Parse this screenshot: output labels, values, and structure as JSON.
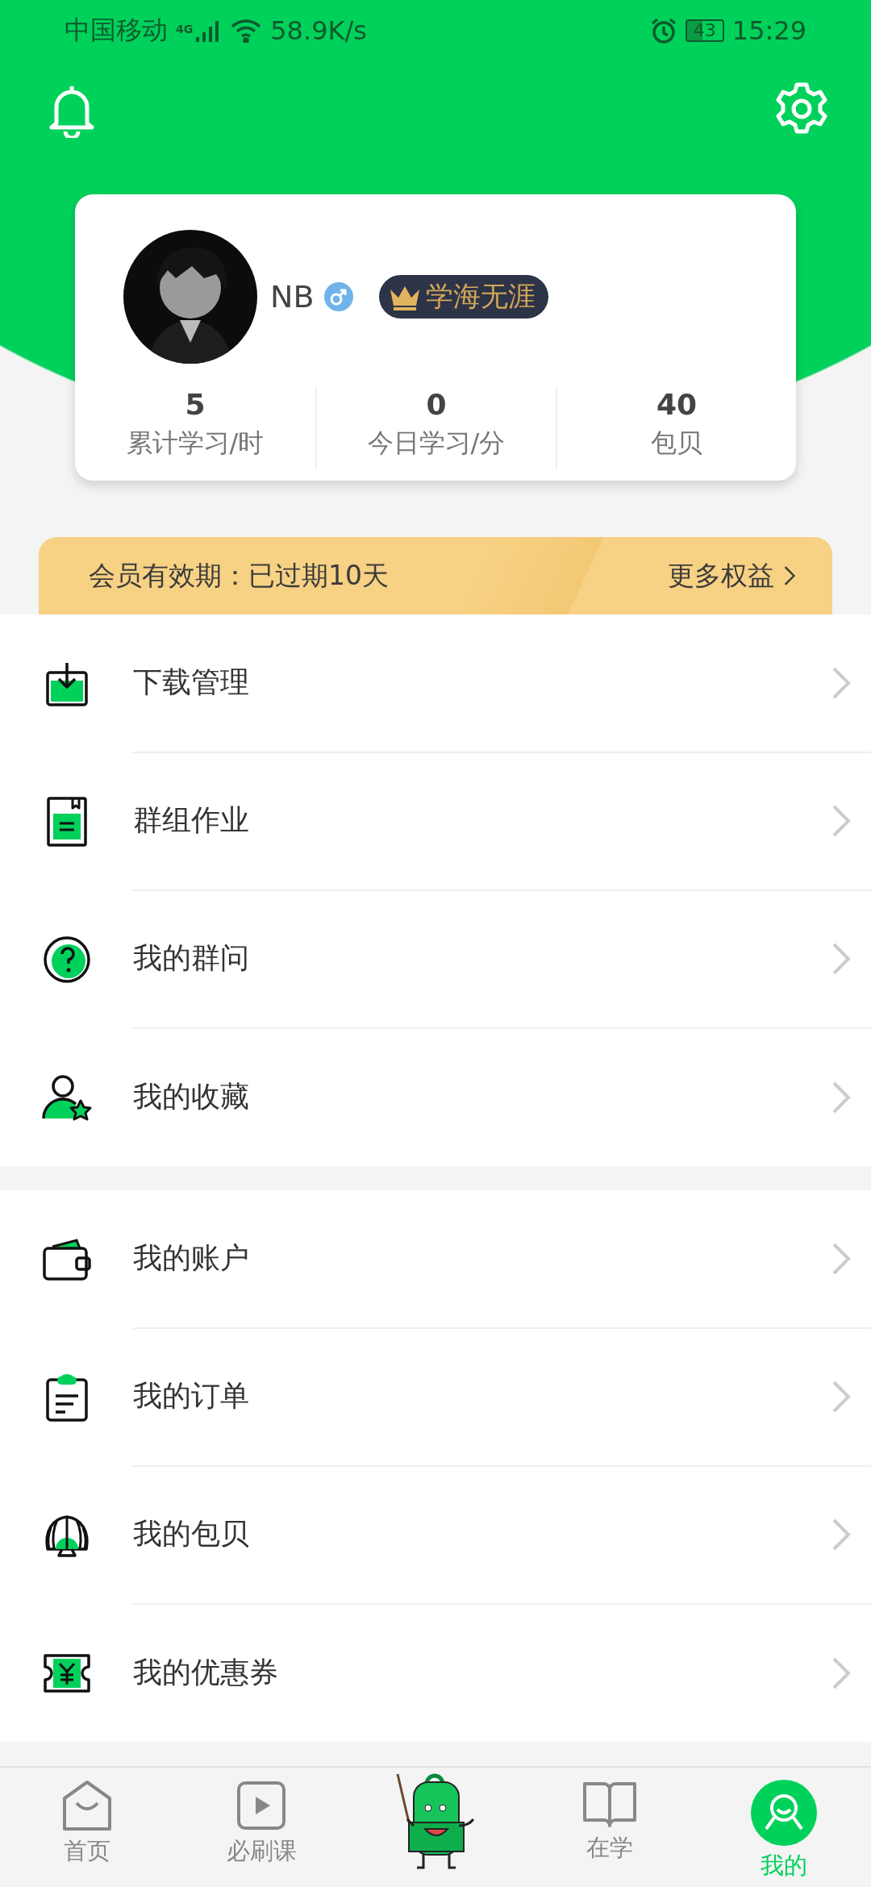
{
  "status_bar": {
    "carrier": "中国移动",
    "network": "4G",
    "speed": "58.9K/s",
    "battery": "43",
    "time": "15:29"
  },
  "profile": {
    "name": "NB",
    "badge": "学海无涯"
  },
  "stats": [
    {
      "value": "5",
      "label": "累计学习/时"
    },
    {
      "value": "0",
      "label": "今日学习/分"
    },
    {
      "value": "40",
      "label": "包贝"
    }
  ],
  "membership": {
    "text": "会员有效期：已过期10天",
    "link": "更多权益"
  },
  "menu_groups": [
    [
      {
        "label": "下载管理"
      },
      {
        "label": "群组作业"
      },
      {
        "label": "我的群问"
      },
      {
        "label": "我的收藏"
      }
    ],
    [
      {
        "label": "我的账户"
      },
      {
        "label": "我的订单"
      },
      {
        "label": "我的包贝"
      },
      {
        "label": "我的优惠券"
      }
    ]
  ],
  "tabs": [
    {
      "kind": "tab",
      "label": "首页",
      "selected": false
    },
    {
      "kind": "tab",
      "label": "必刷课",
      "selected": false
    },
    {
      "kind": "mascot",
      "selected": false
    },
    {
      "kind": "tab",
      "label": "在学",
      "selected": false
    },
    {
      "kind": "tab",
      "label": "我的",
      "selected": true
    }
  ]
}
